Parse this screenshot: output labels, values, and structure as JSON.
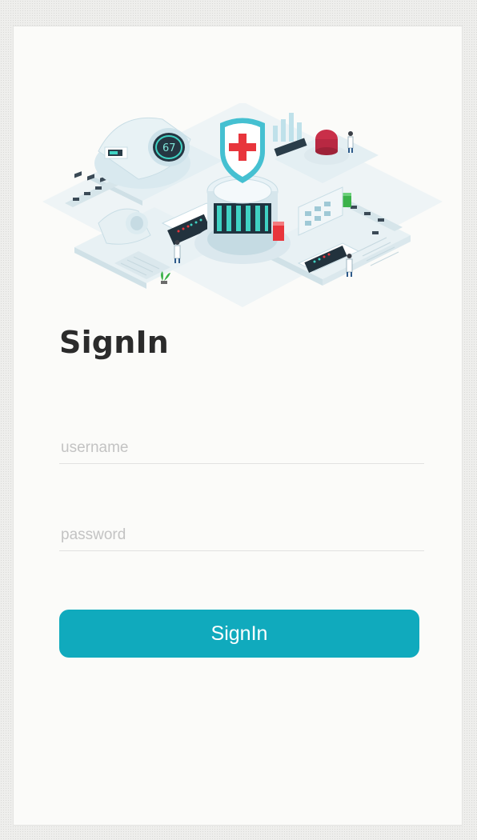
{
  "title": "SignIn",
  "username_field": {
    "placeholder": "username",
    "value": ""
  },
  "password_field": {
    "placeholder": "password",
    "value": ""
  },
  "signin_button": {
    "label": "SignIn"
  },
  "illustration": {
    "gauge_value": "67"
  },
  "colors": {
    "accent": "#10aabd",
    "cross_red": "#e8353c",
    "teal": "#3fb9c9",
    "card_bg": "#fbfbf9",
    "title_text": "#2b2b2b"
  }
}
